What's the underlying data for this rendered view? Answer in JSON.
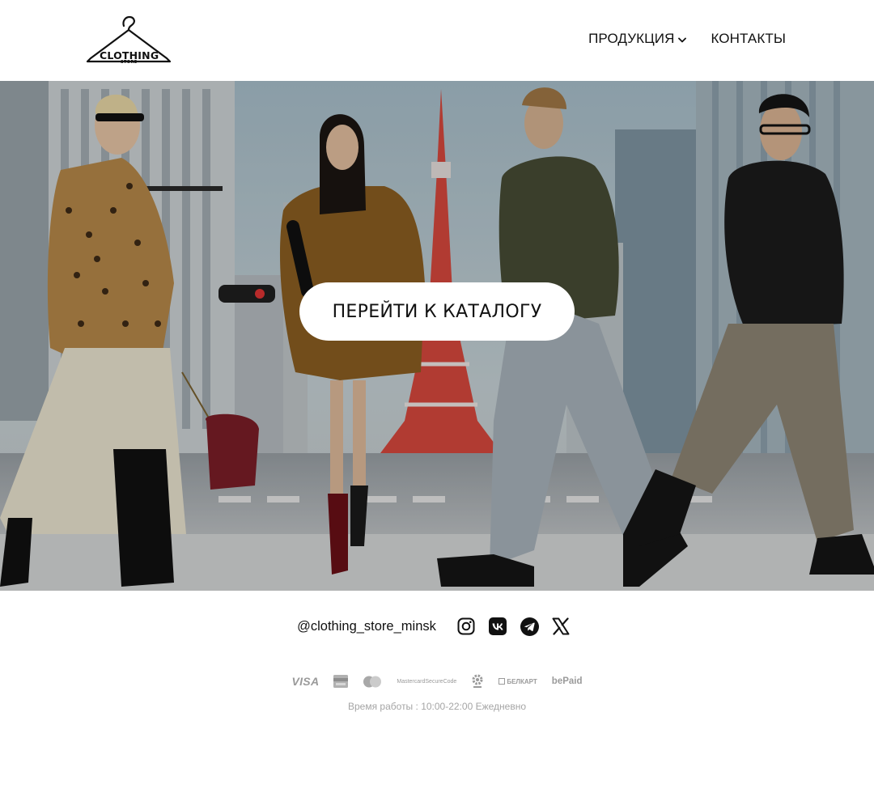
{
  "brand": {
    "logo_main": "CLOTHING",
    "logo_sub": "STORE"
  },
  "nav": {
    "items": [
      {
        "label": "ПРОДУКЦИЯ",
        "icon": "chevron-down-icon"
      },
      {
        "label": "КОНТАКТЫ"
      }
    ]
  },
  "hero": {
    "cta_label": "ПЕРЕЙТИ К КАТАЛОГУ"
  },
  "social": {
    "handle": "@clothing_store_minsk",
    "icons": [
      "instagram-icon",
      "vk-icon",
      "telegram-icon",
      "x-icon"
    ]
  },
  "payments": {
    "visa": "VISA",
    "visa_card_icon": "visa-card-icon",
    "mastercard_icon": "mastercard-icon",
    "mastercard_securecode": [
      "Mastercard",
      "SecureCode"
    ],
    "belkart_icon": "belkart-gear-icon",
    "belkart": "БЕЛКАРТ",
    "bepaid": "bePaid"
  },
  "footer": {
    "hours": "Время работы : 10:00-22:00 Ежедневно"
  },
  "colors": {
    "text": "#111111",
    "muted": "#a5a5a5",
    "background": "#ffffff",
    "cta_bg": "#ffffff"
  }
}
